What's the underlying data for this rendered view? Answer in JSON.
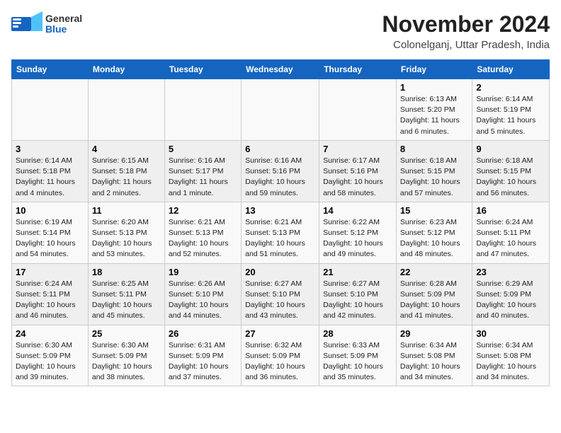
{
  "header": {
    "logo_line1": "General",
    "logo_line2": "Blue",
    "month_title": "November 2024",
    "location": "Colonelganj, Uttar Pradesh, India"
  },
  "days_of_week": [
    "Sunday",
    "Monday",
    "Tuesday",
    "Wednesday",
    "Thursday",
    "Friday",
    "Saturday"
  ],
  "weeks": [
    [
      {
        "day": "",
        "info": ""
      },
      {
        "day": "",
        "info": ""
      },
      {
        "day": "",
        "info": ""
      },
      {
        "day": "",
        "info": ""
      },
      {
        "day": "",
        "info": ""
      },
      {
        "day": "1",
        "info": "Sunrise: 6:13 AM\nSunset: 5:20 PM\nDaylight: 11 hours\nand 6 minutes."
      },
      {
        "day": "2",
        "info": "Sunrise: 6:14 AM\nSunset: 5:19 PM\nDaylight: 11 hours\nand 5 minutes."
      }
    ],
    [
      {
        "day": "3",
        "info": "Sunrise: 6:14 AM\nSunset: 5:18 PM\nDaylight: 11 hours\nand 4 minutes."
      },
      {
        "day": "4",
        "info": "Sunrise: 6:15 AM\nSunset: 5:18 PM\nDaylight: 11 hours\nand 2 minutes."
      },
      {
        "day": "5",
        "info": "Sunrise: 6:16 AM\nSunset: 5:17 PM\nDaylight: 11 hours\nand 1 minute."
      },
      {
        "day": "6",
        "info": "Sunrise: 6:16 AM\nSunset: 5:16 PM\nDaylight: 10 hours\nand 59 minutes."
      },
      {
        "day": "7",
        "info": "Sunrise: 6:17 AM\nSunset: 5:16 PM\nDaylight: 10 hours\nand 58 minutes."
      },
      {
        "day": "8",
        "info": "Sunrise: 6:18 AM\nSunset: 5:15 PM\nDaylight: 10 hours\nand 57 minutes."
      },
      {
        "day": "9",
        "info": "Sunrise: 6:18 AM\nSunset: 5:15 PM\nDaylight: 10 hours\nand 56 minutes."
      }
    ],
    [
      {
        "day": "10",
        "info": "Sunrise: 6:19 AM\nSunset: 5:14 PM\nDaylight: 10 hours\nand 54 minutes."
      },
      {
        "day": "11",
        "info": "Sunrise: 6:20 AM\nSunset: 5:13 PM\nDaylight: 10 hours\nand 53 minutes."
      },
      {
        "day": "12",
        "info": "Sunrise: 6:21 AM\nSunset: 5:13 PM\nDaylight: 10 hours\nand 52 minutes."
      },
      {
        "day": "13",
        "info": "Sunrise: 6:21 AM\nSunset: 5:13 PM\nDaylight: 10 hours\nand 51 minutes."
      },
      {
        "day": "14",
        "info": "Sunrise: 6:22 AM\nSunset: 5:12 PM\nDaylight: 10 hours\nand 49 minutes."
      },
      {
        "day": "15",
        "info": "Sunrise: 6:23 AM\nSunset: 5:12 PM\nDaylight: 10 hours\nand 48 minutes."
      },
      {
        "day": "16",
        "info": "Sunrise: 6:24 AM\nSunset: 5:11 PM\nDaylight: 10 hours\nand 47 minutes."
      }
    ],
    [
      {
        "day": "17",
        "info": "Sunrise: 6:24 AM\nSunset: 5:11 PM\nDaylight: 10 hours\nand 46 minutes."
      },
      {
        "day": "18",
        "info": "Sunrise: 6:25 AM\nSunset: 5:11 PM\nDaylight: 10 hours\nand 45 minutes."
      },
      {
        "day": "19",
        "info": "Sunrise: 6:26 AM\nSunset: 5:10 PM\nDaylight: 10 hours\nand 44 minutes."
      },
      {
        "day": "20",
        "info": "Sunrise: 6:27 AM\nSunset: 5:10 PM\nDaylight: 10 hours\nand 43 minutes."
      },
      {
        "day": "21",
        "info": "Sunrise: 6:27 AM\nSunset: 5:10 PM\nDaylight: 10 hours\nand 42 minutes."
      },
      {
        "day": "22",
        "info": "Sunrise: 6:28 AM\nSunset: 5:09 PM\nDaylight: 10 hours\nand 41 minutes."
      },
      {
        "day": "23",
        "info": "Sunrise: 6:29 AM\nSunset: 5:09 PM\nDaylight: 10 hours\nand 40 minutes."
      }
    ],
    [
      {
        "day": "24",
        "info": "Sunrise: 6:30 AM\nSunset: 5:09 PM\nDaylight: 10 hours\nand 39 minutes."
      },
      {
        "day": "25",
        "info": "Sunrise: 6:30 AM\nSunset: 5:09 PM\nDaylight: 10 hours\nand 38 minutes."
      },
      {
        "day": "26",
        "info": "Sunrise: 6:31 AM\nSunset: 5:09 PM\nDaylight: 10 hours\nand 37 minutes."
      },
      {
        "day": "27",
        "info": "Sunrise: 6:32 AM\nSunset: 5:09 PM\nDaylight: 10 hours\nand 36 minutes."
      },
      {
        "day": "28",
        "info": "Sunrise: 6:33 AM\nSunset: 5:09 PM\nDaylight: 10 hours\nand 35 minutes."
      },
      {
        "day": "29",
        "info": "Sunrise: 6:34 AM\nSunset: 5:08 PM\nDaylight: 10 hours\nand 34 minutes."
      },
      {
        "day": "30",
        "info": "Sunrise: 6:34 AM\nSunset: 5:08 PM\nDaylight: 10 hours\nand 34 minutes."
      }
    ]
  ]
}
